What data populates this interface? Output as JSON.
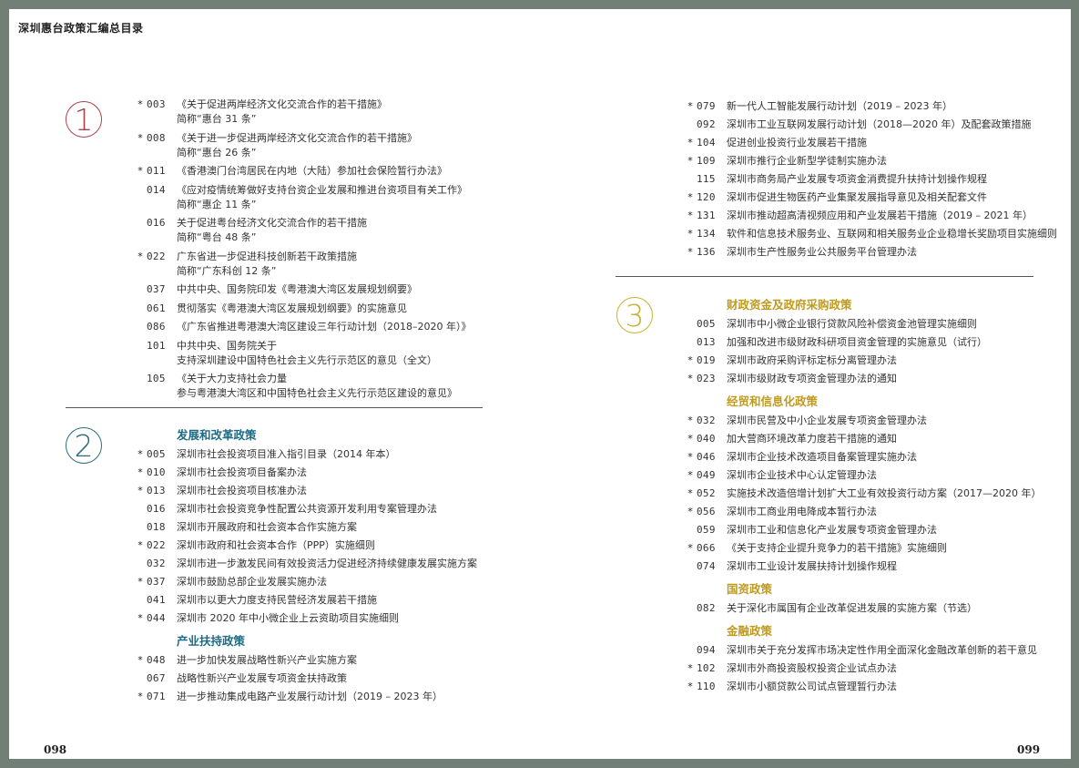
{
  "running_head": "深圳惠台政策汇编总目录",
  "page_left": "098",
  "page_right": "099",
  "section_numbers": {
    "s1": "1",
    "s2": "2",
    "s3": "3"
  },
  "sec1": [
    {
      "star": "*",
      "num": "003",
      "title": "《关于促进两岸经济文化交流合作的若干措施》",
      "alias": "简称“惠台 31 条”"
    },
    {
      "star": "*",
      "num": "008",
      "title": "《关于进一步促进两岸经济文化交流合作的若干措施》",
      "alias": "简称“惠台 26 条”"
    },
    {
      "star": "*",
      "num": "011",
      "title": "《香港澳门台湾居民在内地（大陆）参加社会保险暂行办法》"
    },
    {
      "star": "",
      "num": "014",
      "title": "《应对疫情统筹做好支持台资企业发展和推进台资项目有关工作》",
      "alias": "简称“惠企 11 条”"
    },
    {
      "star": "",
      "num": "016",
      "title": "关于促进粤台经济文化交流合作的若干措施",
      "alias": "简称“粤台 48 条”"
    },
    {
      "star": "*",
      "num": "022",
      "title": "广东省进一步促进科技创新若干政策措施",
      "alias": "简称“广东科创 12 条”"
    },
    {
      "star": "",
      "num": "037",
      "title": "中共中央、国务院印发《粤港澳大湾区发展规划纲要》"
    },
    {
      "star": "",
      "num": "061",
      "title": "贯彻落实《粤港澳大湾区发展规划纲要》的实施意见"
    },
    {
      "star": "",
      "num": "086",
      "title": "《广东省推进粤港澳大湾区建设三年行动计划（2018–2020 年）》"
    },
    {
      "star": "",
      "num": "101",
      "title": "中共中央、国务院关于",
      "cont": "支持深圳建设中国特色社会主义先行示范区的意见（全文）"
    },
    {
      "star": "",
      "num": "105",
      "title": "《关于大力支持社会力量",
      "cont": "参与粤港澳大湾区和中国特色社会主义先行示范区建设的意见》"
    }
  ],
  "sec2": {
    "heading1": "发展和改革政策",
    "list1": [
      {
        "star": "*",
        "num": "005",
        "title": "深圳市社会投资项目准入指引目录（2014 年本）"
      },
      {
        "star": "*",
        "num": "010",
        "title": "深圳市社会投资项目备案办法"
      },
      {
        "star": "*",
        "num": "013",
        "title": "深圳市社会投资项目核准办法"
      },
      {
        "star": "",
        "num": "016",
        "title": "深圳市社会投资竞争性配置公共资源开发利用专案管理办法"
      },
      {
        "star": "",
        "num": "018",
        "title": "深圳市开展政府和社会资本合作实施方案"
      },
      {
        "star": "*",
        "num": "022",
        "title": "深圳市政府和社会资本合作（PPP）实施细则"
      },
      {
        "star": "",
        "num": "032",
        "title": "深圳市进一步激发民间有效投资活力促进经济持续健康发展实施方案"
      },
      {
        "star": "*",
        "num": "037",
        "title": "深圳市鼓励总部企业发展实施办法"
      },
      {
        "star": "",
        "num": "041",
        "title": "深圳市以更大力度支持民营经济发展若干措施"
      },
      {
        "star": "*",
        "num": "044",
        "title": "深圳市 2020 年中小微企业上云资助项目实施细则"
      }
    ],
    "heading2": "产业扶持政策",
    "list2": [
      {
        "star": "*",
        "num": "048",
        "title": "进一步加快发展战略性新兴产业实施方案"
      },
      {
        "star": "",
        "num": "067",
        "title": "战略性新兴产业发展专项资金扶持政策"
      },
      {
        "star": "*",
        "num": "071",
        "title": "进一步推动集成电路产业发展行动计划（2019 – 2023 年）"
      }
    ]
  },
  "right_top": [
    {
      "star": "*",
      "num": "079",
      "title": "新一代人工智能发展行动计划（2019 – 2023 年）"
    },
    {
      "star": "",
      "num": "092",
      "title": "深圳市工业互联网发展行动计划（2018—2020 年）及配套政策措施"
    },
    {
      "star": "*",
      "num": "104",
      "title": "促进创业投资行业发展若干措施"
    },
    {
      "star": "*",
      "num": "109",
      "title": "深圳市推行企业新型学徒制实施办法"
    },
    {
      "star": "",
      "num": "115",
      "title": "深圳市商务局产业发展专项资金消费提升扶持计划操作规程"
    },
    {
      "star": "*",
      "num": "120",
      "title": "深圳市促进生物医药产业集聚发展指导意见及相关配套文件"
    },
    {
      "star": "*",
      "num": "131",
      "title": "深圳市推动超高清视频应用和产业发展若干措施（2019 – 2021 年）"
    },
    {
      "star": "*",
      "num": "134",
      "title": "软件和信息技术服务业、互联网和相关服务业企业稳增长奖励项目实施细则"
    },
    {
      "star": "*",
      "num": "136",
      "title": "深圳市生产性服务业公共服务平台管理办法"
    }
  ],
  "sec3": {
    "heading1": "财政资金及政府采购政策",
    "list1": [
      {
        "star": "",
        "num": "005",
        "title": "深圳市中小微企业银行贷款风险补偿资金池管理实施细则"
      },
      {
        "star": "",
        "num": "013",
        "title": "加强和改进市级财政科研项目资金管理的实施意见（试行）"
      },
      {
        "star": "*",
        "num": "019",
        "title": "深圳市政府采购评标定标分离管理办法"
      },
      {
        "star": "*",
        "num": "023",
        "title": "深圳市级财政专项资金管理办法的通知"
      }
    ],
    "heading2": "经贸和信息化政策",
    "list2": [
      {
        "star": "*",
        "num": "032",
        "title": "深圳市民营及中小企业发展专项资金管理办法"
      },
      {
        "star": "*",
        "num": "040",
        "title": "加大营商环境改革力度若干措施的通知"
      },
      {
        "star": "*",
        "num": "046",
        "title": "深圳市企业技术改造项目备案管理实施办法"
      },
      {
        "star": "*",
        "num": "049",
        "title": "深圳市企业技术中心认定管理办法"
      },
      {
        "star": "*",
        "num": "052",
        "title": "实施技术改造倍增计划扩大工业有效投资行动方案（2017—2020 年）"
      },
      {
        "star": "*",
        "num": "056",
        "title": "深圳市工商业用电降成本暂行办法"
      },
      {
        "star": "",
        "num": "059",
        "title": "深圳市工业和信息化产业发展专项资金管理办法"
      },
      {
        "star": "*",
        "num": "066",
        "title": "《关于支持企业提升竞争力的若干措施》实施细则"
      },
      {
        "star": "",
        "num": "074",
        "title": "深圳市工业设计发展扶持计划操作规程"
      }
    ],
    "heading3": "国资政策",
    "list3": [
      {
        "star": "",
        "num": "082",
        "title": "关于深化市属国有企业改革促进发展的实施方案（节选）"
      }
    ],
    "heading4": "金融政策",
    "list4": [
      {
        "star": "",
        "num": "094",
        "title": "深圳市关于充分发挥市场决定性作用全面深化金融改革创新的若干意见"
      },
      {
        "star": "*",
        "num": "102",
        "title": "深圳市外商投资股权投资企业试点办法"
      },
      {
        "star": "*",
        "num": "110",
        "title": "深圳市小额贷款公司试点管理暂行办法"
      }
    ]
  }
}
